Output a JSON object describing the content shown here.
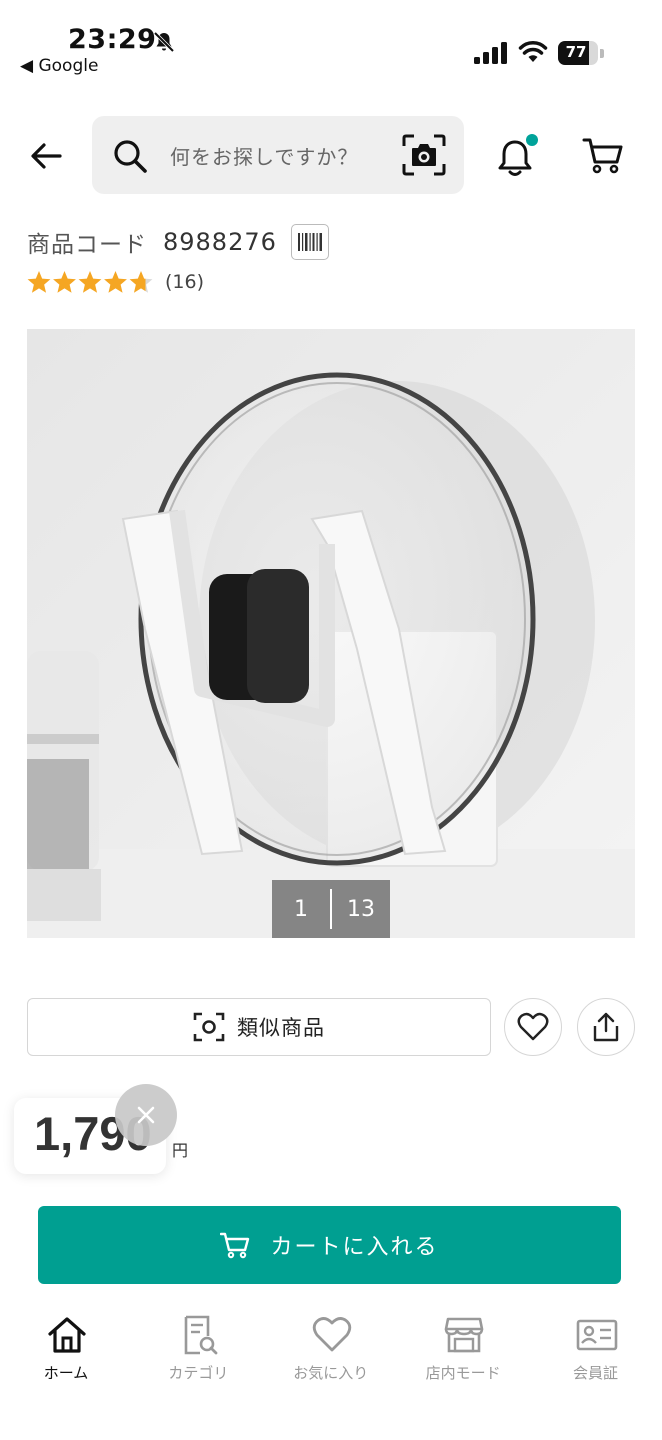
{
  "status_bar": {
    "time": "23:29",
    "back_app": "◀ Google",
    "battery": "77",
    "battery_level_percent": 77
  },
  "header": {
    "search_placeholder": "何をお探しですか？",
    "icons": [
      "back-arrow-icon",
      "search-icon",
      "camera-scan-icon",
      "bell-icon",
      "cart-icon"
    ],
    "notification_dot_color": "#00a39a"
  },
  "product": {
    "code_label": "商品コード",
    "code_value": "8988276",
    "rating_stars": 4.7,
    "review_count": "(16)",
    "image_index": "1",
    "image_total": "13",
    "price": "1,790",
    "price_unit": "円"
  },
  "actions": {
    "similar_label": "類似商品"
  },
  "cart_button": {
    "label": "カートに入れる",
    "color": "#009f91"
  },
  "bottom_nav": {
    "items": [
      {
        "label": "ホーム",
        "icon": "home-icon",
        "active": true
      },
      {
        "label": "カテゴリ",
        "icon": "category-icon",
        "active": false
      },
      {
        "label": "お気に入り",
        "icon": "heart-icon",
        "active": false
      },
      {
        "label": "店内モード",
        "icon": "store-icon",
        "active": false
      },
      {
        "label": "会員証",
        "icon": "member-card-icon",
        "active": false
      }
    ]
  },
  "colors": {
    "star": "#f5a623",
    "accent": "#009f91"
  }
}
